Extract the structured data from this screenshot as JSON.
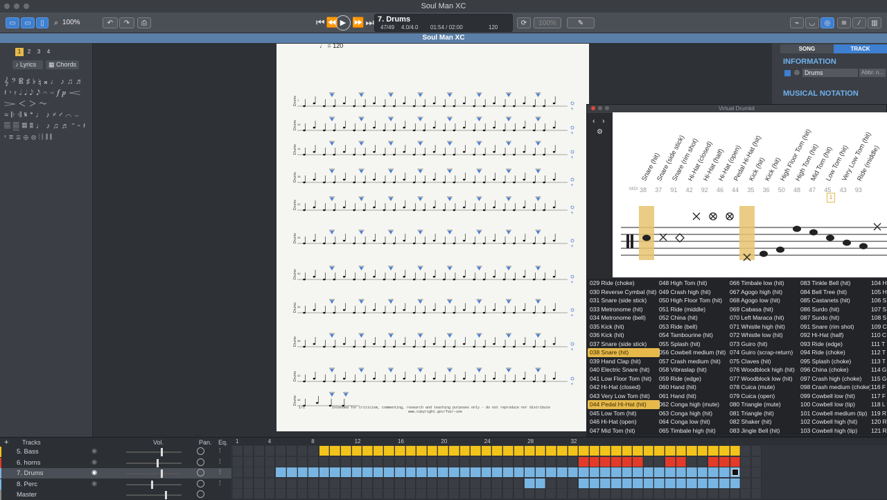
{
  "window": {
    "title": "Soul Man XC"
  },
  "document": {
    "title": "Soul Man XC"
  },
  "toolbar": {
    "zoom": "100%",
    "zoom_right": "100%"
  },
  "transport": {
    "track_name": "7. Drums",
    "position": "47/49",
    "time_sig": "4.0/4.0",
    "time": "01:54 / 02:00",
    "tempo": "120"
  },
  "left_panel": {
    "voice_numbers": [
      "1",
      "2",
      "3",
      "4"
    ],
    "lyrics_label": "Lyrics",
    "chords_label": "Chords"
  },
  "score": {
    "tempo_mark": "♩ = 120",
    "footer": "Intended for criticism, commenting, research and teaching purposes only  -  do not reproduce nor distribute",
    "footer_url": "www.copyright.gov/fair-use",
    "page_num": "1/1",
    "measure_numbers": [
      "1",
      "10",
      "14",
      "18",
      "22",
      "26",
      "30",
      "34",
      "38",
      "42",
      "46"
    ]
  },
  "right_panel": {
    "tabs": [
      "SONG",
      "TRACK"
    ],
    "information_heading": "INFORMATION",
    "track_name": "Drums",
    "abbr_placeholder": "Abbr. n...",
    "notation_heading": "MUSICAL NOTATION"
  },
  "virtual_drumkit": {
    "title": "Virtual Drumkit",
    "midi_label": "MIDI",
    "pieces": [
      {
        "name": "Snare (hit)",
        "midi": "38"
      },
      {
        "name": "Snare (side stick)",
        "midi": "37"
      },
      {
        "name": "Snare (rim shot)",
        "midi": "91"
      },
      {
        "name": "Hi-Hat (closed)",
        "midi": "42"
      },
      {
        "name": "Hi-Hat (half)",
        "midi": "92"
      },
      {
        "name": "Hi-Hat (open)",
        "midi": "46"
      },
      {
        "name": "Pedal Hi-Hat (hit)",
        "midi": "44"
      },
      {
        "name": "Kick (hit)",
        "midi": "35"
      },
      {
        "name": "Kick (hit)",
        "midi": "36"
      },
      {
        "name": "High Floor Tom (hit)",
        "midi": "50"
      },
      {
        "name": "High Tom (hit)",
        "midi": "48"
      },
      {
        "name": "Mid Tom (hit)",
        "midi": "47"
      },
      {
        "name": "Low Tom (hit)",
        "midi": "45"
      },
      {
        "name": "Very Low Tom (hit)",
        "midi": "43"
      },
      {
        "name": "Ride (middle)",
        "midi": "93"
      }
    ],
    "highlight_midi": "1",
    "columns": [
      [
        "029 Ride (choke)",
        "030 Reverse Cymbal (hit)",
        "031 Snare (side stick)",
        "033 Metronome (hit)",
        "034 Metronome (bell)",
        "035 Kick (hit)",
        "036 Kick (hit)",
        "037 Snare (side stick)",
        "038 Snare (hit)",
        "039 Hand Clap (hit)",
        "040 Electric Snare (hit)",
        "041 Low Floor Tom (hit)",
        "042 Hi-Hat (closed)",
        "043 Very Low Tom (hit)",
        "044 Pedal Hi-Hat (hit)",
        "045 Low Tom (hit)",
        "046 Hi-Hat (open)",
        "047 Mid Tom (hit)"
      ],
      [
        "048 High Tom (hit)",
        "049 Crash high (hit)",
        "050 High Floor Tom (hit)",
        "051 Ride (middle)",
        "052 China (hit)",
        "053 Ride (bell)",
        "054 Tambourine (hit)",
        "055 Splash (hit)",
        "056 Cowbell medium (hit)",
        "057 Crash medium (hit)",
        "058 Vibraslap (hit)",
        "059 Ride (edge)",
        "060 Hand (hit)",
        "061 Hand (hit)",
        "062 Conga high (mute)",
        "063 Conga high (hit)",
        "064 Conga low (hit)",
        "065 Timbale high (hit)"
      ],
      [
        "066 Timbale low (hit)",
        "067 Agogo high (hit)",
        "068 Agogo low (hit)",
        "069 Cabasa (hit)",
        "070 Left Maraca (hit)",
        "071 Whistle high (hit)",
        "072 Whistle low (hit)",
        "073 Guiro (hit)",
        "074 Guiro (scrap-return)",
        "075 Claves (hit)",
        "076 Woodblock high (hit)",
        "077 Woodblock low (hit)",
        "078 Cuica (mute)",
        "079 Cuica (open)",
        "080 Triangle (mute)",
        "081 Triangle (hit)",
        "082 Shaker (hit)",
        "083 Jingle Bell (hit)"
      ],
      [
        "083 Tinkle Bell (hit)",
        "084 Bell Tree (hit)",
        "085 Castanets (hit)",
        "086 Surdo (hit)",
        "087 Surdo (hit)",
        "091 Snare (rim shot)",
        "092 Hi-Hat (half)",
        "093 Ride (edge)",
        "094 Ride (choke)",
        "095 Splash (choke)",
        "096 China (choke)",
        "097 Crash high (choke)",
        "098 Crash medium (choke)",
        "099 Cowbell low (hit)",
        "100 Cowbell low (tip)",
        "101 Cowbell medium (tip)",
        "102 Cowbell high (hit)",
        "103 Cowbell high (tip)"
      ],
      [
        "104 H",
        "105 H",
        "106 S",
        "107 S",
        "108 S",
        "109 C",
        "110 C",
        "111 T",
        "112 T",
        "113 T",
        "114 G",
        "115 G",
        "116 F",
        "117 F",
        "118 L",
        "119 R",
        "120 R",
        "121 R"
      ]
    ],
    "selected": [
      "038 Snare (hit)",
      "044 Pedal Hi-Hat (hit)"
    ]
  },
  "tracks_panel": {
    "header_label": "Tracks",
    "vol_label": "Vol.",
    "pan_label": "Pan.",
    "eq_label": "Eq.",
    "ruler": [
      "1",
      "4",
      "8",
      "12",
      "16",
      "20",
      "24",
      "28",
      "32"
    ],
    "tracks": [
      {
        "name": "5. Bass",
        "color": "#f2c31b",
        "volume": 0.62
      },
      {
        "name": "6. horns",
        "color": "#e23b2a",
        "volume": 0.55
      },
      {
        "name": "7. Drums",
        "color": "#79b5e2",
        "volume": 0.62
      },
      {
        "name": "8. Perc",
        "color": "#79b5e2",
        "volume": 0.45
      },
      {
        "name": "Master",
        "color": "#888888",
        "volume": 0.7
      }
    ]
  }
}
